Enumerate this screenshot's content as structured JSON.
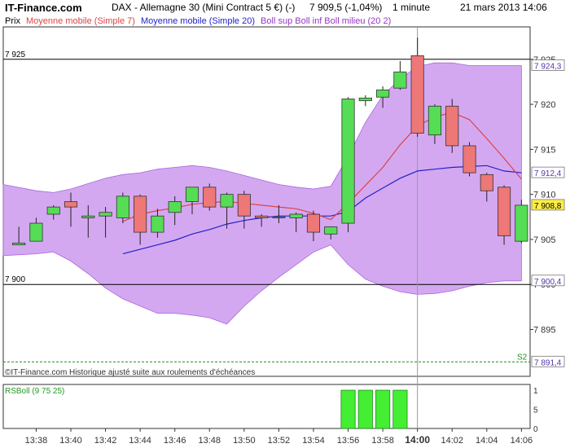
{
  "header": {
    "site": "IT-Finance.com",
    "instrument": "DAX - Allemagne 30 (Mini Contract 5 €) (-)",
    "quote": "7 909,5 (-1,04%)",
    "period": "1 minute",
    "datetime": "21 mars 2013 14:06"
  },
  "legend": {
    "price": "Prix",
    "sma7": "Moyenne mobile (Simple 7)",
    "sma20": "Moyenne mobile (Simple 20)",
    "boll": "Boll sup Boll inf Boll milieu (20 2)"
  },
  "indicator_label": "RSBoll (9 75 25)",
  "copyright": "©IT-Finance.com Historique ajusté suite aux roulements d'échéances",
  "s2_label": "S2",
  "colors": {
    "up": "#55dd55",
    "down": "#ee7777",
    "sma7": "#dd4444",
    "sma20": "#2222cc",
    "band": "#cc99ee",
    "band_edge": "#aa66dd",
    "last_price_bg": "#ffee44",
    "support": "#228822",
    "rsboll": "#44ee33"
  },
  "chart_data": [
    {
      "type": "candlestick",
      "x_ticks": [
        "13:38",
        "13:40",
        "13:42",
        "13:44",
        "13:46",
        "13:48",
        "13:50",
        "13:52",
        "13:54",
        "13:56",
        "13:58",
        "14:00",
        "14:02",
        "14:04",
        "14:06"
      ],
      "x_time": [
        "13:37",
        "13:38",
        "13:39",
        "13:40",
        "13:41",
        "13:42",
        "13:43",
        "13:44",
        "13:45",
        "13:46",
        "13:47",
        "13:48",
        "13:49",
        "13:50",
        "13:51",
        "13:52",
        "13:53",
        "13:54",
        "13:55",
        "13:56",
        "13:57",
        "13:58",
        "13:59",
        "14:00",
        "14:01",
        "14:02",
        "14:03",
        "14:04",
        "14:05",
        "14:06"
      ],
      "y_ticks": [
        7895,
        7900,
        7905,
        7910,
        7915,
        7920,
        7925
      ],
      "y_tick_labels": [
        "7 895",
        "7 900",
        "7 905",
        "7 910",
        "7 915",
        "7 920",
        "7 925"
      ],
      "ylim": [
        7889.8,
        7928.6
      ],
      "candles": [
        {
          "o": 7904.4,
          "h": 7906.4,
          "l": 7904.4,
          "c": 7904.6
        },
        {
          "o": 7904.8,
          "h": 7907.4,
          "l": 7904.8,
          "c": 7906.8
        },
        {
          "o": 7907.8,
          "h": 7908.8,
          "l": 7907.2,
          "c": 7908.6
        },
        {
          "o": 7909.2,
          "h": 7910.2,
          "l": 7906.4,
          "c": 7908.6
        },
        {
          "o": 7907.4,
          "h": 7908.8,
          "l": 7905.2,
          "c": 7907.6
        },
        {
          "o": 7907.6,
          "h": 7908.6,
          "l": 7905.2,
          "c": 7908.0
        },
        {
          "o": 7907.4,
          "h": 7910.2,
          "l": 7906.8,
          "c": 7909.8
        },
        {
          "o": 7909.8,
          "h": 7910.0,
          "l": 7904.4,
          "c": 7905.8
        },
        {
          "o": 7905.8,
          "h": 7908.4,
          "l": 7905.2,
          "c": 7907.6
        },
        {
          "o": 7908.0,
          "h": 7909.8,
          "l": 7906.6,
          "c": 7909.2
        },
        {
          "o": 7909.2,
          "h": 7910.8,
          "l": 7907.8,
          "c": 7910.8
        },
        {
          "o": 7910.8,
          "h": 7911.2,
          "l": 7908.2,
          "c": 7908.6
        },
        {
          "o": 7908.6,
          "h": 7910.2,
          "l": 7906.2,
          "c": 7910.0
        },
        {
          "o": 7910.0,
          "h": 7910.4,
          "l": 7906.2,
          "c": 7907.6
        },
        {
          "o": 7907.6,
          "h": 7907.8,
          "l": 7906.4,
          "c": 7907.4
        },
        {
          "o": 7907.4,
          "h": 7908.8,
          "l": 7906.8,
          "c": 7907.5
        },
        {
          "o": 7907.4,
          "h": 7908.0,
          "l": 7905.8,
          "c": 7907.8
        },
        {
          "o": 7907.8,
          "h": 7908.2,
          "l": 7904.8,
          "c": 7905.8
        },
        {
          "o": 7905.6,
          "h": 7906.2,
          "l": 7905.0,
          "c": 7906.4
        },
        {
          "o": 7906.8,
          "h": 7920.8,
          "l": 7905.8,
          "c": 7920.6
        },
        {
          "o": 7920.4,
          "h": 7921.0,
          "l": 7919.8,
          "c": 7920.7
        },
        {
          "o": 7920.8,
          "h": 7922.0,
          "l": 7919.6,
          "c": 7921.6
        },
        {
          "o": 7921.8,
          "h": 7924.8,
          "l": 7921.6,
          "c": 7923.6
        },
        {
          "o": 7925.4,
          "h": 7927.4,
          "l": 7916.4,
          "c": 7916.8
        },
        {
          "o": 7916.6,
          "h": 7920.0,
          "l": 7915.6,
          "c": 7919.8
        },
        {
          "o": 7919.8,
          "h": 7920.6,
          "l": 7914.6,
          "c": 7915.4
        },
        {
          "o": 7915.4,
          "h": 7915.8,
          "l": 7912.0,
          "c": 7912.4
        },
        {
          "o": 7912.2,
          "h": 7912.4,
          "l": 7909.2,
          "c": 7910.4
        },
        {
          "o": 7910.8,
          "h": 7911.0,
          "l": 7904.4,
          "c": 7905.4
        },
        {
          "o": 7904.8,
          "h": 7909.4,
          "l": 7904.6,
          "c": 7908.8
        }
      ],
      "sma7": [
        null,
        null,
        null,
        null,
        null,
        null,
        7907.0,
        7907.8,
        7908.2,
        7908.5,
        7908.9,
        7909.1,
        7909.2,
        7909.0,
        7908.8,
        7908.6,
        7908.4,
        7907.9,
        7907.2,
        7909.0,
        7911.0,
        7913.0,
        7915.5,
        7917.6,
        7918.6,
        7919.1,
        7918.3,
        7916.2,
        7914.0,
        7911.7
      ],
      "sma20": [
        null,
        null,
        null,
        null,
        null,
        null,
        7903.4,
        7903.9,
        7904.4,
        7904.9,
        7905.6,
        7906.1,
        7906.7,
        7907.1,
        7907.4,
        7907.6,
        7907.6,
        7907.6,
        7907.6,
        7908.1,
        7909.6,
        7910.7,
        7911.8,
        7912.6,
        7912.8,
        7913.0,
        7913.1,
        7913.2,
        7912.6,
        7912.4
      ],
      "boll_upper": [
        7911.1,
        7910.4,
        7910.2,
        7910.6,
        7911.2,
        7911.8,
        7912.2,
        7912.4,
        7912.8,
        7913.0,
        7913.2,
        7913.0,
        7912.6,
        7912.1,
        7911.6,
        7911.1,
        7910.8,
        7910.6,
        7910.9,
        7914.2,
        7918.0,
        7921.0,
        7922.8,
        7924.2,
        7924.6,
        7924.6,
        7924.3,
        7924.3,
        7924.3,
        7924.3
      ],
      "boll_lower": [
        7903.2,
        7903.4,
        7903.6,
        7902.6,
        7901.2,
        7899.6,
        7898.4,
        7897.6,
        7896.8,
        7896.8,
        7896.6,
        7896.3,
        7895.6,
        7897.6,
        7899.3,
        7900.8,
        7902.2,
        7903.6,
        7904.4,
        7902.2,
        7900.6,
        7899.8,
        7899.2,
        7898.9,
        7899.0,
        7899.3,
        7899.8,
        7900.2,
        7900.4,
        7900.4
      ],
      "reference_lines": [
        7925,
        7900
      ],
      "reference_line_labels": [
        "7 925",
        "7 900"
      ],
      "axis_badges": [
        {
          "value": 7924.3,
          "label": "7 924,3"
        },
        {
          "value": 7912.4,
          "label": "7 912,4"
        },
        {
          "value": 7908.8,
          "label": "7 908,8",
          "highlight": true
        },
        {
          "value": 7900.4,
          "label": "7 900,4"
        },
        {
          "value": 7891.4,
          "label": "7 891,4"
        }
      ],
      "support_level": 7891.4,
      "cursor_time": "14:00"
    },
    {
      "type": "bar",
      "title": "RSBoll (9 75 25)",
      "y_ticks": [
        0,
        0.5,
        1
      ],
      "y_tick_labels": [
        "0",
        "5",
        "1"
      ],
      "ylim": [
        0,
        1.15
      ],
      "values": [
        0,
        0,
        0,
        0,
        0,
        0,
        0,
        0,
        0,
        0,
        0,
        0,
        0,
        0,
        0,
        0,
        0,
        0,
        0,
        1,
        1,
        1,
        1,
        0,
        0,
        0,
        0,
        0,
        0,
        0
      ]
    }
  ]
}
